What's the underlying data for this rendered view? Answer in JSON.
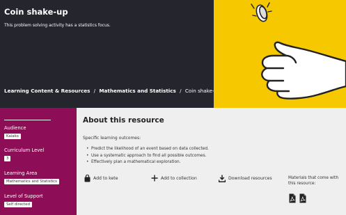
{
  "hero": {
    "title": "Coin shake-up",
    "subtitle": "This problem solving activity has a statistics focus.",
    "breadcrumb": [
      "Learning Content & Resources",
      "Mathematics and Statistics"
    ],
    "breadcrumb_separator": "/",
    "breadcrumb_current": "Coin shake-up",
    "colors": {
      "dark": "#25252d",
      "yellow": "#f5c800"
    },
    "illustration_icon": "hand-flipping-coin"
  },
  "sidebar": {
    "background": "#8d0e56",
    "fields": [
      {
        "label": "Audience",
        "value": "Kaiako"
      },
      {
        "label": "Curriculum Level",
        "value": "3"
      },
      {
        "label": "Learning Area",
        "value": "Mathematics and Statistics"
      },
      {
        "label": "Level of Support",
        "value": "Self directed"
      }
    ]
  },
  "main": {
    "heading": "About this resource",
    "outcomes_heading": "Specific learning outcomes:",
    "outcomes": [
      "Predict the likelihood of an event based on data collected.",
      "Use a systematic approach to find all possible outcomes.",
      "Effectively plan a mathematical exploration."
    ],
    "actions": [
      {
        "label": "Add to kete",
        "icon": "bag-icon"
      },
      {
        "label": "Add to collection",
        "icon": "plus-icon"
      },
      {
        "label": "Download resources",
        "icon": "download-icon"
      }
    ],
    "materials_label": "Materials that come with this resource:",
    "materials": [
      {
        "icon": "pdf-icon"
      },
      {
        "icon": "pdf-icon"
      }
    ]
  }
}
